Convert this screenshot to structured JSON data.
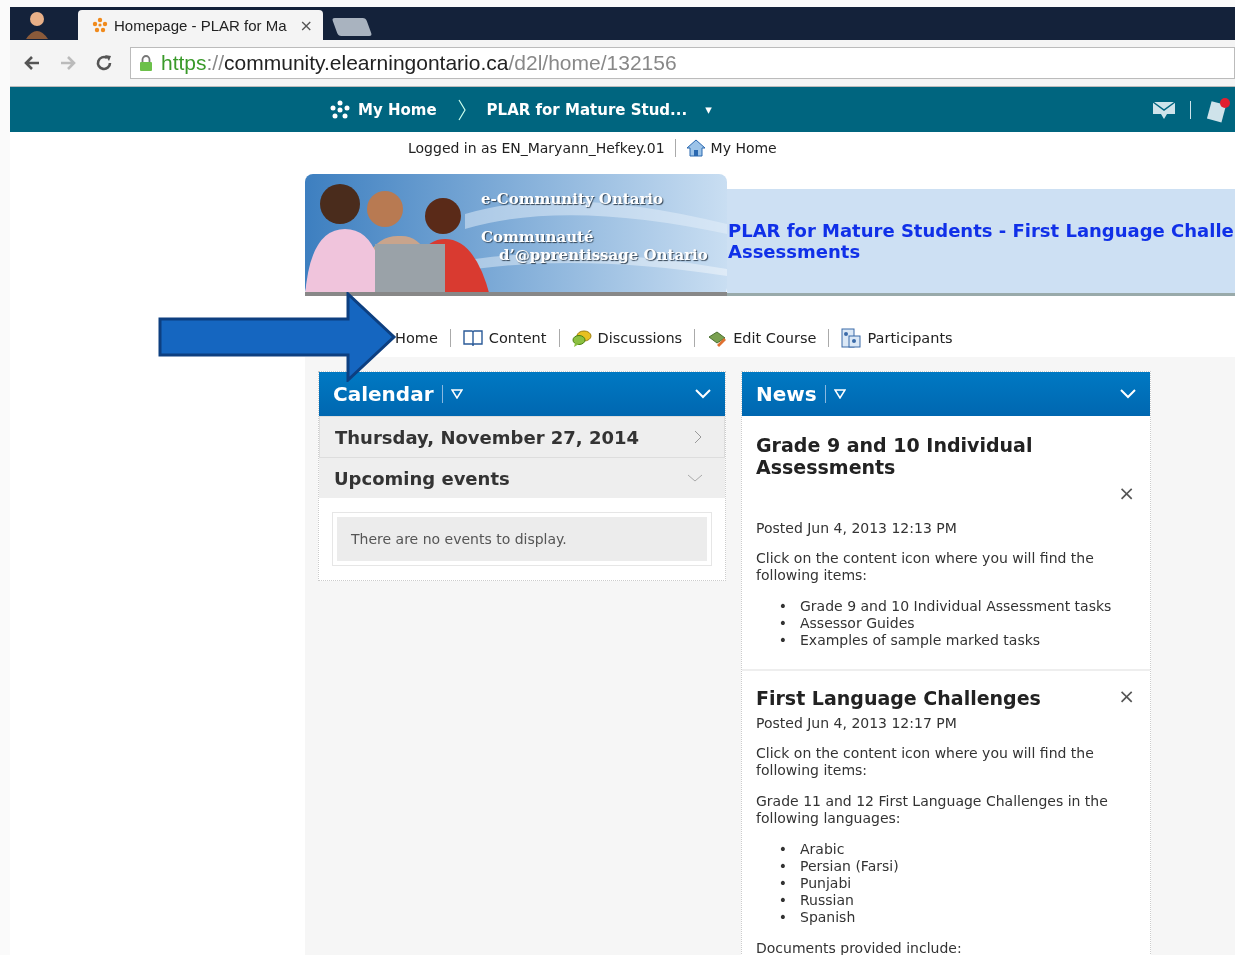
{
  "browser": {
    "tab_title": "Homepage - PLAR for Ma",
    "tab_close": "×",
    "url": [
      {
        "kind": "scheme",
        "text": "https"
      },
      {
        "kind": "path",
        "text": "://"
      },
      {
        "kind": "host",
        "text": "community.elearningontario.ca"
      },
      {
        "kind": "path",
        "text": "/d2l/home/132156"
      }
    ]
  },
  "navbar": {
    "home": "My Home",
    "course": "PLAR for Mature Stud...",
    "caret": "▾",
    "alert": true
  },
  "user_line": {
    "logged_in": "Logged in as EN_Maryann_Hefkey.01",
    "home_link": "My Home"
  },
  "banner": {
    "lines": [
      "e-Community  Ontario",
      "Communauté",
      "d’@pprentissage Ontario"
    ],
    "title_lines": [
      "PLAR for Mature Students - First Language Challe",
      "Assessments"
    ]
  },
  "course_nav": [
    {
      "kind": "home",
      "label": "Home"
    },
    {
      "kind": "content",
      "label": "Content"
    },
    {
      "kind": "discussions",
      "label": "Discussions"
    },
    {
      "kind": "edit",
      "label": "Edit Course"
    },
    {
      "kind": "participants",
      "label": "Participants"
    }
  ],
  "calendar": {
    "title": "Calendar",
    "date": "Thursday, November 27, 2014",
    "upcoming": "Upcoming events",
    "empty": "There are no events to display."
  },
  "news": {
    "title": "News",
    "items": [
      {
        "title": "Grade 9 and 10 Individual Assessments",
        "close": "×",
        "posted": "Posted Jun 4, 2013 12:13 PM",
        "blocks": [
          {
            "kind": "paragraph",
            "text": "Click on the content icon where you will find the following items:"
          },
          {
            "kind": "list",
            "marker": "•",
            "items": [
              "Grade 9 and 10 Individual Assessment tasks",
              "Assessor Guides",
              "Examples of sample marked tasks"
            ]
          }
        ]
      },
      {
        "title": "First Language Challenges",
        "close": "×",
        "posted": "Posted Jun 4, 2013 12:17 PM",
        "blocks": [
          {
            "kind": "paragraph",
            "text": "Click on the content icon where you will find the following items:"
          },
          {
            "kind": "paragraph",
            "text": "Grade 11 and 12 First Language Challenges in the following languages:"
          },
          {
            "kind": "list",
            "marker": "•",
            "items": [
              "Arabic",
              "Persian (Farsi)",
              "Punjabi",
              "Russian",
              "Spanish"
            ]
          },
          {
            "kind": "paragraph",
            "text": "Documents provided include:"
          }
        ]
      }
    ]
  }
}
